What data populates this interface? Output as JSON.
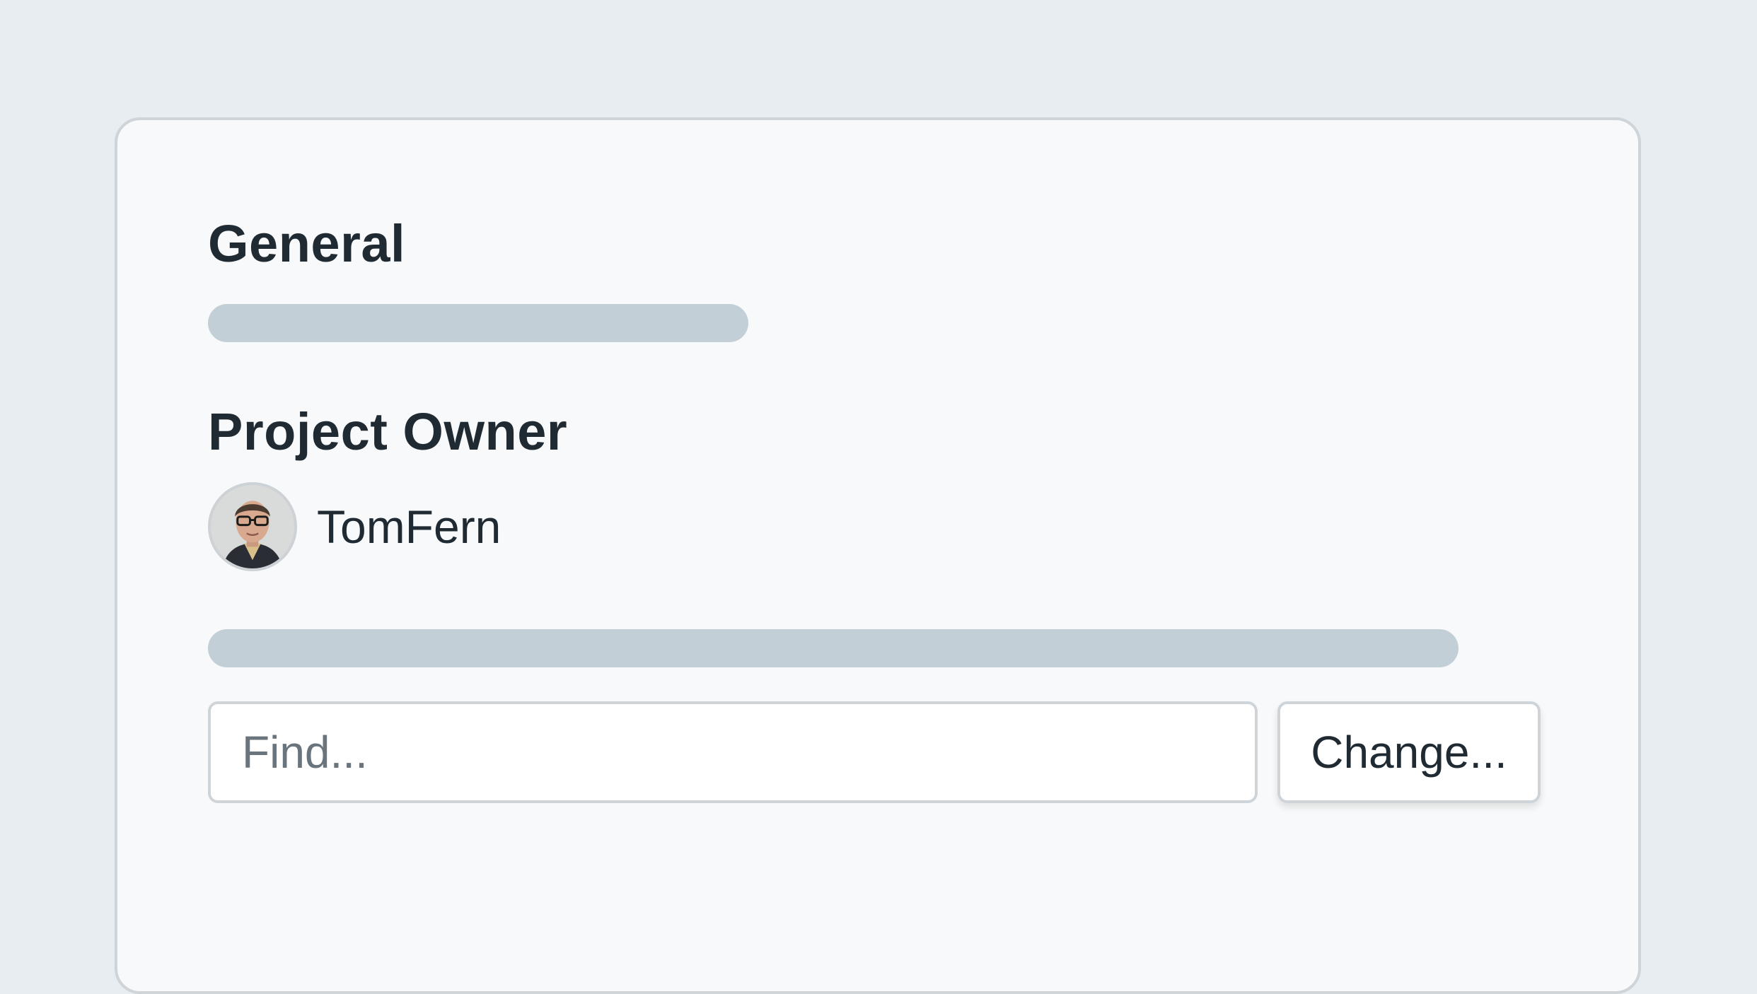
{
  "sections": {
    "general": {
      "title": "General"
    },
    "project_owner": {
      "title": "Project Owner",
      "owner_name": "TomFern"
    }
  },
  "owner_search": {
    "placeholder": "Find...",
    "value": ""
  },
  "change_button": {
    "label": "Change..."
  },
  "colors": {
    "page_background": "#e8edf1",
    "panel_background": "#f7f9fa",
    "skeleton": "#c3cfd6",
    "text": "#1f2a33",
    "placeholder": "#6a747c"
  }
}
